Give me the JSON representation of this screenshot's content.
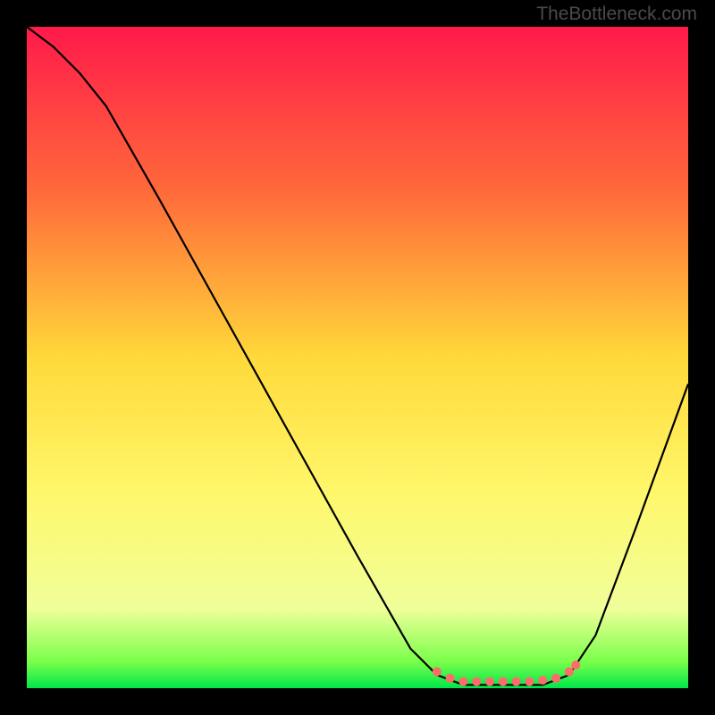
{
  "watermark": "TheBottleneck.com",
  "chart_data": {
    "type": "line",
    "xlim": [
      0,
      100
    ],
    "ylim": [
      0,
      100
    ],
    "title": "",
    "xlabel": "",
    "ylabel": "",
    "gradient_stops": [
      {
        "offset": 0,
        "color": "#ff1a4a"
      },
      {
        "offset": 25,
        "color": "#ff6a3a"
      },
      {
        "offset": 50,
        "color": "#ffd93a"
      },
      {
        "offset": 70,
        "color": "#fff76a"
      },
      {
        "offset": 88,
        "color": "#f0ff9a"
      },
      {
        "offset": 96,
        "color": "#7aff4a"
      },
      {
        "offset": 100,
        "color": "#00e64a"
      }
    ],
    "curve": [
      {
        "x": 0,
        "y": 100
      },
      {
        "x": 4,
        "y": 97
      },
      {
        "x": 8,
        "y": 93
      },
      {
        "x": 12,
        "y": 88
      },
      {
        "x": 20,
        "y": 74
      },
      {
        "x": 30,
        "y": 56
      },
      {
        "x": 40,
        "y": 38
      },
      {
        "x": 50,
        "y": 20
      },
      {
        "x": 58,
        "y": 6
      },
      {
        "x": 62,
        "y": 2
      },
      {
        "x": 66,
        "y": 0.5
      },
      {
        "x": 72,
        "y": 0.5
      },
      {
        "x": 78,
        "y": 0.5
      },
      {
        "x": 82,
        "y": 2
      },
      {
        "x": 86,
        "y": 8
      },
      {
        "x": 92,
        "y": 24
      },
      {
        "x": 100,
        "y": 46
      }
    ],
    "markers": [
      {
        "x": 62,
        "y": 2.5
      },
      {
        "x": 64,
        "y": 1.5
      },
      {
        "x": 66,
        "y": 1
      },
      {
        "x": 68,
        "y": 1
      },
      {
        "x": 70,
        "y": 1
      },
      {
        "x": 72,
        "y": 1
      },
      {
        "x": 74,
        "y": 1
      },
      {
        "x": 76,
        "y": 1
      },
      {
        "x": 78,
        "y": 1.2
      },
      {
        "x": 80,
        "y": 1.5
      },
      {
        "x": 82,
        "y": 2.5
      },
      {
        "x": 83,
        "y": 3.5
      }
    ],
    "marker_color": "#ff6b6b",
    "curve_color": "#000000"
  }
}
